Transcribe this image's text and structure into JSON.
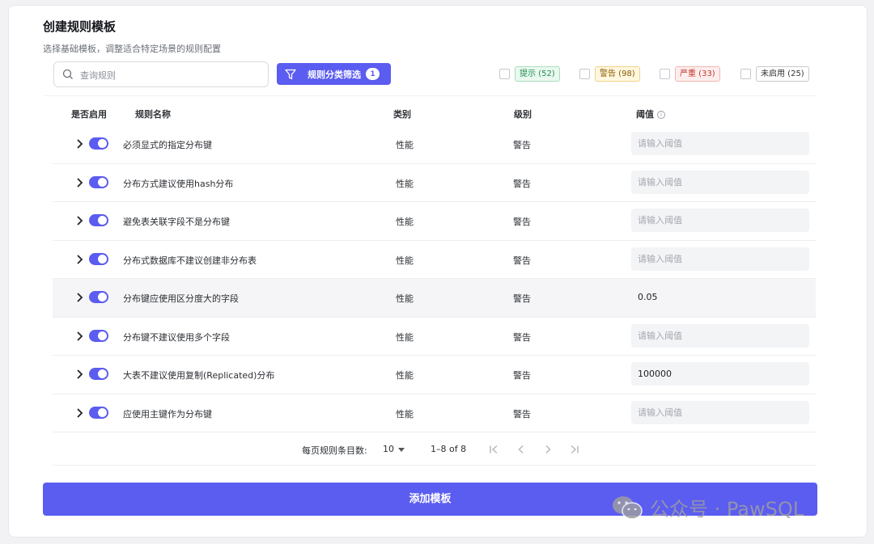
{
  "header": {
    "title": "创建规则模板",
    "subtitle": "选择基础模板，调整适合特定场景的规则配置"
  },
  "toolbar": {
    "search_placeholder": "查询规则",
    "filter_label": "规则分类筛选",
    "filter_count": "1",
    "levels": [
      {
        "label": "提示 (52)",
        "color": "#1f8f52"
      },
      {
        "label": "警告 (98)",
        "color": "#8a5a00"
      },
      {
        "label": "严重 (33)",
        "color": "#c0392b"
      },
      {
        "label": "未启用 (25)",
        "color": "#333333"
      }
    ]
  },
  "table": {
    "columns": {
      "enabled": "是否启用",
      "name": "规则名称",
      "category": "类别",
      "level": "级别",
      "threshold": "阈值"
    },
    "threshold_placeholder": "请输入阈值",
    "rows": [
      {
        "name": "必须显式的指定分布键",
        "category": "性能",
        "level": "警告",
        "threshold": ""
      },
      {
        "name": "分布方式建议使用hash分布",
        "category": "性能",
        "level": "警告",
        "threshold": ""
      },
      {
        "name": "避免表关联字段不是分布键",
        "category": "性能",
        "level": "警告",
        "threshold": ""
      },
      {
        "name": "分布式数据库不建议创建非分布表",
        "category": "性能",
        "level": "警告",
        "threshold": ""
      },
      {
        "name": "分布键应使用区分度大的字段",
        "category": "性能",
        "level": "警告",
        "threshold": "0.05"
      },
      {
        "name": "分布键不建议使用多个字段",
        "category": "性能",
        "level": "警告",
        "threshold": ""
      },
      {
        "name": "大表不建议使用复制(Replicated)分布",
        "category": "性能",
        "level": "警告",
        "threshold": "100000"
      },
      {
        "name": "应使用主键作为分布键",
        "category": "性能",
        "level": "警告",
        "threshold": ""
      }
    ]
  },
  "pagination": {
    "rows_per_page_label": "每页规则条目数:",
    "rows_per_page": "10",
    "range": "1–8 of 8"
  },
  "footer": {
    "add_label": "添加模板"
  },
  "watermark": {
    "text": "公众号 · PawSQL"
  }
}
